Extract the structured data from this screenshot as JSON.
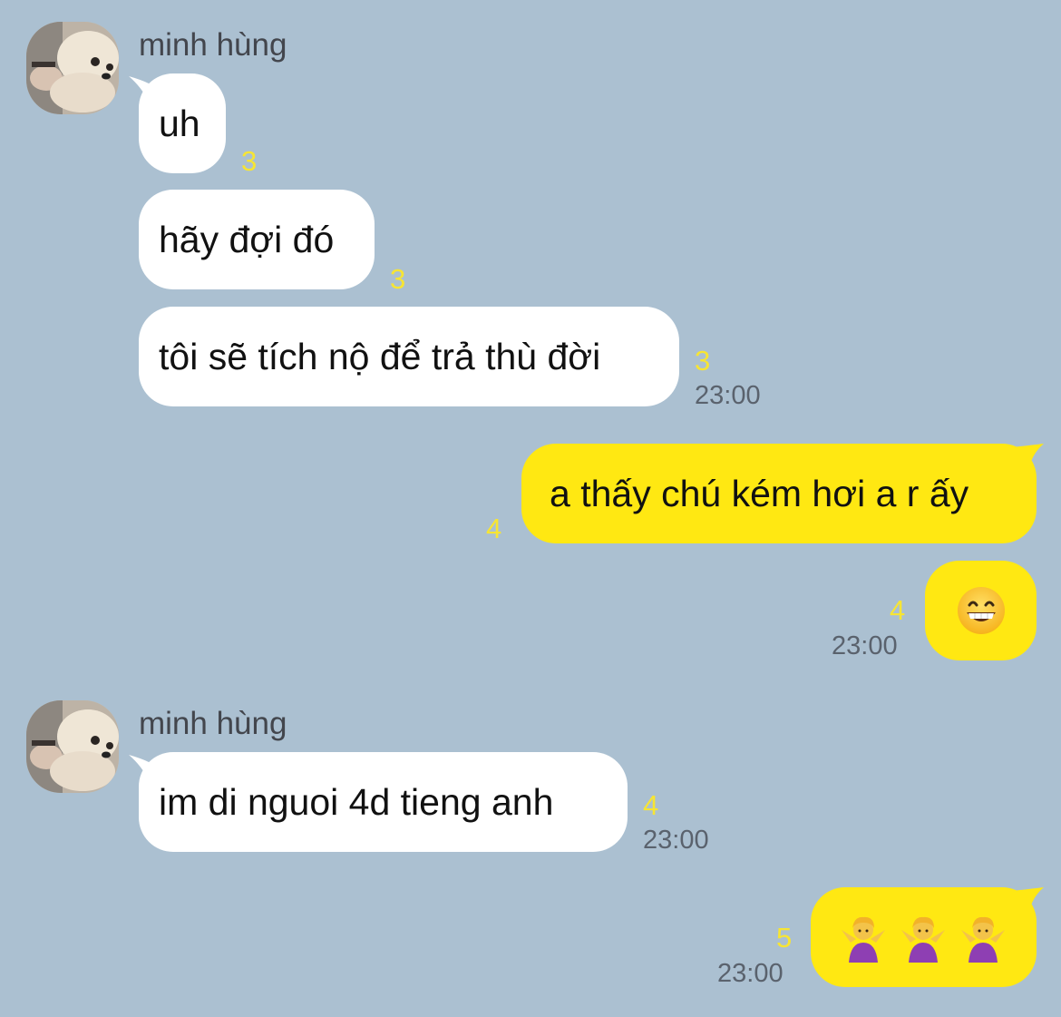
{
  "accent_colors": {
    "background": "#abc0d1",
    "incoming_bubble": "#ffffff",
    "outgoing_bubble": "#ffe812",
    "unread_count": "#f7e533"
  },
  "messages": [
    {
      "sender": "minh hùng",
      "text": "uh",
      "unread": "3"
    },
    {
      "text": "hãy đợi đó",
      "unread": "3"
    },
    {
      "text": "tôi sẽ tích nộ để trả thù đời",
      "unread": "3",
      "time": "23:00"
    },
    {
      "text": "a thấy chú kém hơi a r ấy",
      "unread": "4"
    },
    {
      "emoji": "grinning-face-with-smiling-eyes",
      "unread": "4",
      "time": "23:00"
    },
    {
      "sender": "minh hùng",
      "text": "im di nguoi 4d tieng anh",
      "unread": "4",
      "time": "23:00"
    },
    {
      "emoji": "person-shrugging",
      "emoji_count": 3,
      "unread": "5",
      "time": "23:00"
    }
  ]
}
